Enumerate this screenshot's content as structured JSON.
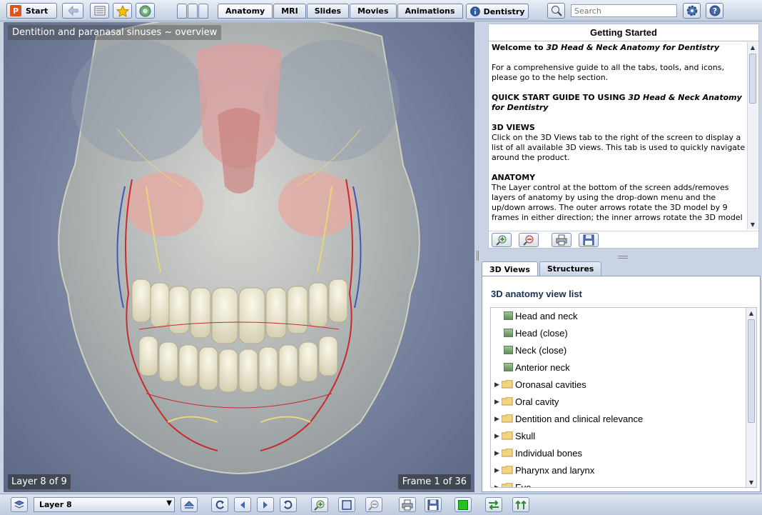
{
  "toolbar": {
    "start_label": "Start",
    "tabs": [
      "Anatomy",
      "MRI",
      "Slides",
      "Movies",
      "Animations"
    ],
    "active_tab": "Anatomy",
    "dentistry_label": "Dentistry",
    "search_placeholder": "Search"
  },
  "viewer": {
    "caption": "Dentition and paranasal sinuses ~ overview",
    "layer_status": "Layer 8 of 9",
    "frame_status": "Frame 1 of 36"
  },
  "getting_started": {
    "title": "Getting Started",
    "welcome_prefix": "Welcome to ",
    "product_name": "3D Head & Neck Anatomy for Dentistry",
    "intro": "For a comprehensive guide to all the tabs, tools, and icons, please go to the help section.",
    "quick_start_prefix": "QUICK START GUIDE TO USING ",
    "views_heading": "3D VIEWS",
    "views_text": "Click on the 3D Views tab to the right of the screen to display a list of all available 3D views. This tab is used to quickly navigate around the product.",
    "anatomy_heading": "ANATOMY",
    "anatomy_text": "The Layer control at the bottom of the screen adds/removes layers of anatomy by using the drop-down menu and the up/down arrows. The outer arrows rotate the 3D model by 9 frames in either direction; the inner arrows rotate the 3D model"
  },
  "views_panel": {
    "tabs": [
      "3D Views",
      "Structures"
    ],
    "active_tab": "3D Views",
    "heading": "3D anatomy view list",
    "items": [
      {
        "label": "Head and neck",
        "type": "view"
      },
      {
        "label": "Head (close)",
        "type": "view"
      },
      {
        "label": "Neck (close)",
        "type": "view"
      },
      {
        "label": "Anterior neck",
        "type": "view"
      },
      {
        "label": "Oronasal cavities",
        "type": "folder"
      },
      {
        "label": "Oral cavity",
        "type": "folder"
      },
      {
        "label": "Dentition and clinical relevance",
        "type": "folder"
      },
      {
        "label": "Skull",
        "type": "folder"
      },
      {
        "label": "Individual bones",
        "type": "folder"
      },
      {
        "label": "Pharynx and larynx",
        "type": "folder"
      },
      {
        "label": "Eye",
        "type": "folder"
      }
    ]
  },
  "bottom_bar": {
    "layer_select_value": "Layer 8"
  },
  "colors": {
    "accent": "#e0531c",
    "status_green": "#22c21c"
  }
}
